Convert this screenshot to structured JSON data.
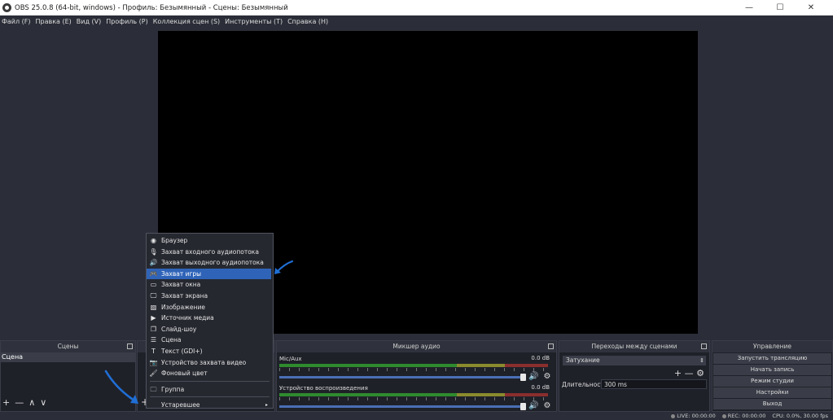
{
  "window": {
    "title": "OBS 25.0.8 (64-bit, windows) - Профиль: Безымянный - Сцены: Безымянный",
    "controls": [
      "—",
      "☐",
      "✕"
    ]
  },
  "menubar": [
    "Файл (F)",
    "Правка (E)",
    "Вид (V)",
    "Профиль (P)",
    "Коллекция сцен (S)",
    "Инструменты (T)",
    "Справка (H)"
  ],
  "scenes": {
    "header": "Сцены",
    "items": [
      "Сцена"
    ],
    "toolbar": [
      "+",
      "—",
      "∧",
      "∨"
    ]
  },
  "sources": {
    "add_label": "+"
  },
  "mixer": {
    "header": "Микшер аудио",
    "channels": [
      {
        "name": "Mic/Aux",
        "db": "0.0 dB",
        "volume": 1.0
      },
      {
        "name": "Устройство воспроизведения",
        "db": "0.0 dB",
        "volume": 1.0
      }
    ]
  },
  "transitions": {
    "header": "Переходы между сценами",
    "selected": "Затухание",
    "buttons": [
      "+",
      "—",
      "⚙"
    ],
    "duration_label": "Длительность",
    "duration_value": "300 ms"
  },
  "controls": {
    "header": "Управление",
    "buttons": [
      "Запустить трансляцию",
      "Начать запись",
      "Режим студии",
      "Настройки",
      "Выход"
    ]
  },
  "statusbar": {
    "live": "LIVE: 00:00:00",
    "rec": "REC: 00:00:00",
    "cpu": "CPU: 0.0%, 30.00 fps"
  },
  "context_menu": {
    "items": [
      {
        "label": "Браузер",
        "icon": "globe-icon",
        "glyph": "◉"
      },
      {
        "label": "Захват входного аудиопотока",
        "icon": "microphone-icon",
        "glyph": "🎙"
      },
      {
        "label": "Захват выходного аудиопотока",
        "icon": "speaker-icon",
        "glyph": "🔊"
      },
      {
        "label": "Захват игры",
        "icon": "gamepad-icon",
        "glyph": "🎮",
        "highlighted": true
      },
      {
        "label": "Захват окна",
        "icon": "window-icon",
        "glyph": "▭"
      },
      {
        "label": "Захват экрана",
        "icon": "monitor-icon",
        "glyph": "🖵"
      },
      {
        "label": "Изображение",
        "icon": "image-icon",
        "glyph": "▨"
      },
      {
        "label": "Источник медиа",
        "icon": "play-icon",
        "glyph": "▶"
      },
      {
        "label": "Слайд-шоу",
        "icon": "slideshow-icon",
        "glyph": "❐"
      },
      {
        "label": "Сцена",
        "icon": "list-icon",
        "glyph": "☰"
      },
      {
        "label": "Текст (GDI+)",
        "icon": "text-icon",
        "glyph": "T"
      },
      {
        "label": "Устройство захвата видео",
        "icon": "camera-icon",
        "glyph": "📷"
      },
      {
        "label": "Фоновый цвет",
        "icon": "brush-icon",
        "glyph": "🖌"
      }
    ],
    "group": {
      "label": "Группа",
      "icon": "folder-icon",
      "glyph": "🗀"
    },
    "deprecated": {
      "label": "Устаревшее",
      "arrow": "▸"
    }
  },
  "colors": {
    "background": "#2b2e38",
    "highlight": "#2f63b8",
    "annotation_arrow": "#1f6fd6"
  }
}
